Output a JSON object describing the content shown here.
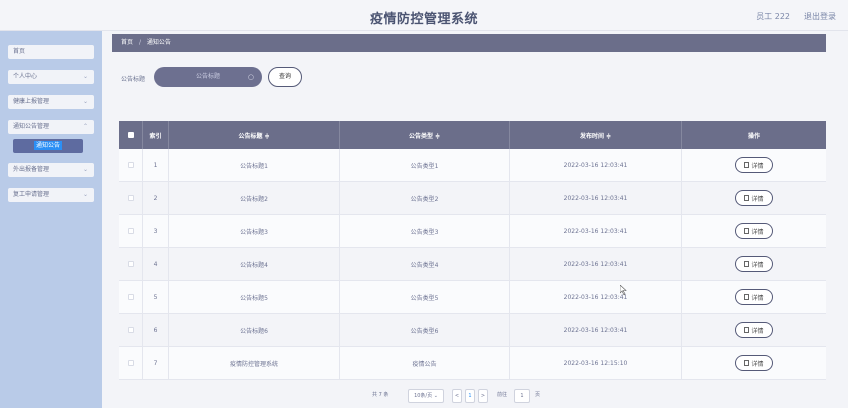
{
  "header": {
    "title": "疫情防控管理系统",
    "user": "员工 222",
    "logout": "退出登录"
  },
  "sidebar": {
    "items": [
      {
        "label": "首页",
        "has_arrow": false
      },
      {
        "label": "个人中心",
        "has_arrow": true
      },
      {
        "label": "健康上报管理",
        "has_arrow": true
      },
      {
        "label": "通知公告管理",
        "has_arrow": true
      },
      {
        "label": "外出报备管理",
        "has_arrow": true
      },
      {
        "label": "复工申请管理",
        "has_arrow": true
      }
    ],
    "active_sub": "通知公告"
  },
  "breadcrumb": {
    "home": "首页",
    "sep": "/",
    "current": "通知公告"
  },
  "search": {
    "label": "公告标题",
    "placeholder": "公告标题",
    "button": "查询"
  },
  "table": {
    "headers": [
      "索引",
      "公告标题 ≑",
      "公告类型 ≑",
      "发布时间 ≑",
      "操作"
    ],
    "rows": [
      {
        "idx": "1",
        "title": "公告标题1",
        "type": "公告类型1",
        "time": "2022-03-16 12:03:41",
        "op": "详情"
      },
      {
        "idx": "2",
        "title": "公告标题2",
        "type": "公告类型2",
        "time": "2022-03-16 12:03:41",
        "op": "详情"
      },
      {
        "idx": "3",
        "title": "公告标题3",
        "type": "公告类型3",
        "time": "2022-03-16 12:03:41",
        "op": "详情"
      },
      {
        "idx": "4",
        "title": "公告标题4",
        "type": "公告类型4",
        "time": "2022-03-16 12:03:41",
        "op": "详情"
      },
      {
        "idx": "5",
        "title": "公告标题5",
        "type": "公告类型5",
        "time": "2022-03-16 12:03:41",
        "op": "详情"
      },
      {
        "idx": "6",
        "title": "公告标题6",
        "type": "公告类型6",
        "time": "2022-03-16 12:03:41",
        "op": "详情"
      },
      {
        "idx": "7",
        "title": "疫情防控管理系统",
        "type": "疫情公告",
        "time": "2022-03-16 12:15:10",
        "op": "详情"
      }
    ]
  },
  "pagination": {
    "total": "共 7 条",
    "page_size": "10条/页",
    "prev": "<",
    "page": "1",
    "next": ">",
    "goto_label": "前往",
    "goto_value": "1",
    "goto_suffix": "页"
  },
  "colors": {
    "header_bg": "#f4f5f9",
    "sidebar_bg": "#b9cbe8",
    "table_header_bg": "#6b6e8a",
    "active_sub_bg": "#5e6ba0",
    "accent": "#2b8ff5"
  },
  "icons": [
    "search-icon",
    "chevron-down-icon",
    "document-icon",
    "sort-icon",
    "cursor-icon"
  ]
}
